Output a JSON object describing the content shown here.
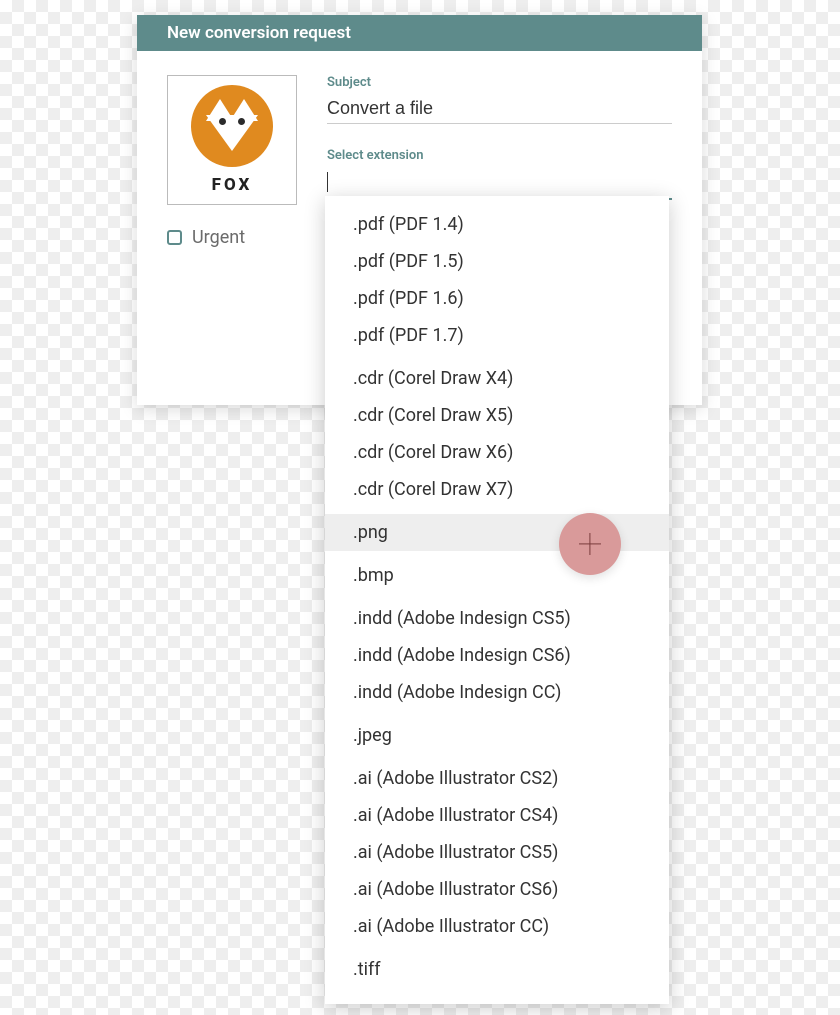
{
  "header": {
    "title": "New conversion request"
  },
  "logo": {
    "text": "FOX"
  },
  "urgent": {
    "label": "Urgent",
    "checked": false
  },
  "fields": {
    "subject": {
      "label": "Subject",
      "value": "Convert a file"
    },
    "extension": {
      "label": "Select extension",
      "value": ""
    }
  },
  "dropdown": {
    "hoveredIndex": 8,
    "groups": [
      [
        ".pdf (PDF 1.4)",
        ".pdf (PDF 1.5)",
        ".pdf (PDF 1.6)",
        ".pdf (PDF 1.7)"
      ],
      [
        ".cdr (Corel Draw X4)",
        ".cdr (Corel Draw X5)",
        ".cdr (Corel Draw X6)",
        ".cdr (Corel Draw X7)"
      ],
      [
        ".png"
      ],
      [
        ".bmp"
      ],
      [
        ".indd (Adobe Indesign CS5)",
        ".indd (Adobe Indesign CS6)",
        ".indd (Adobe Indesign CC)"
      ],
      [
        ".jpeg"
      ],
      [
        ".ai (Adobe Illustrator CS2)",
        ".ai (Adobe Illustrator CS4)",
        ".ai (Adobe Illustrator CS5)",
        ".ai (Adobe Illustrator CS6)",
        ".ai (Adobe Illustrator CC)"
      ],
      [
        ".tiff"
      ]
    ]
  },
  "fab": {
    "icon": "plus-icon"
  }
}
